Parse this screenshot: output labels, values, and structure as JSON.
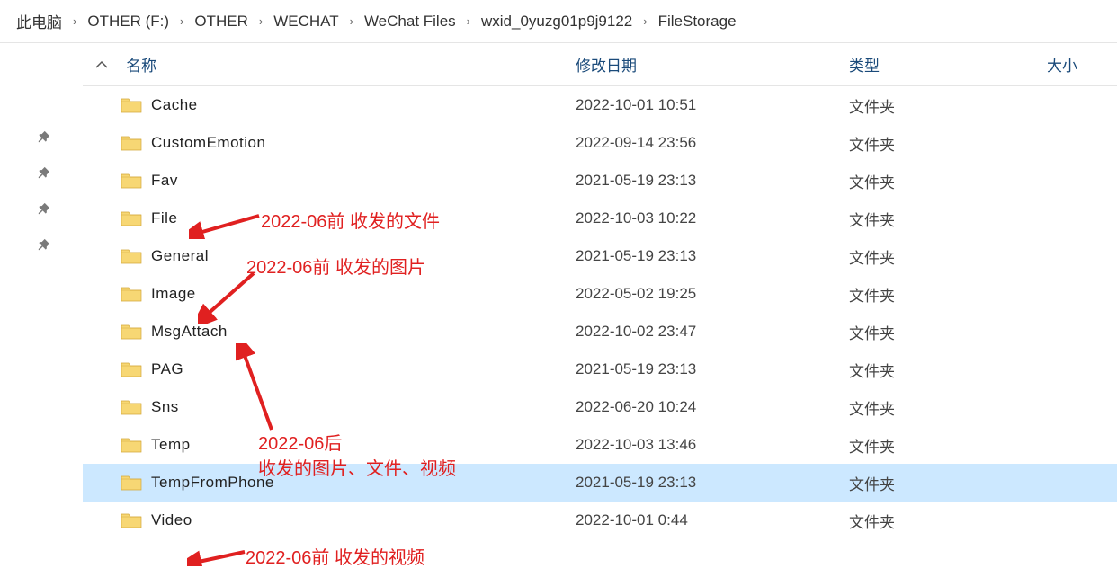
{
  "breadcrumb": [
    {
      "label": "此电脑"
    },
    {
      "label": "OTHER (F:)"
    },
    {
      "label": "OTHER"
    },
    {
      "label": "WECHAT"
    },
    {
      "label": "WeChat Files"
    },
    {
      "label": "wxid_0yuzg01p9j9122"
    },
    {
      "label": "FileStorage"
    }
  ],
  "headers": {
    "name": "名称",
    "date": "修改日期",
    "type": "类型",
    "size": "大小"
  },
  "rows": [
    {
      "name": "Cache",
      "date": "2022-10-01 10:51",
      "type": "文件夹"
    },
    {
      "name": "CustomEmotion",
      "date": "2022-09-14 23:56",
      "type": "文件夹"
    },
    {
      "name": "Fav",
      "date": "2021-05-19 23:13",
      "type": "文件夹"
    },
    {
      "name": "File",
      "date": "2022-10-03 10:22",
      "type": "文件夹"
    },
    {
      "name": "General",
      "date": "2021-05-19 23:13",
      "type": "文件夹"
    },
    {
      "name": "Image",
      "date": "2022-05-02 19:25",
      "type": "文件夹"
    },
    {
      "name": "MsgAttach",
      "date": "2022-10-02 23:47",
      "type": "文件夹"
    },
    {
      "name": "PAG",
      "date": "2021-05-19 23:13",
      "type": "文件夹"
    },
    {
      "name": "Sns",
      "date": "2022-06-20 10:24",
      "type": "文件夹"
    },
    {
      "name": "Temp",
      "date": "2022-10-03 13:46",
      "type": "文件夹"
    },
    {
      "name": "TempFromPhone",
      "date": "2021-05-19 23:13",
      "type": "文件夹"
    },
    {
      "name": "Video",
      "date": "2022-10-01 0:44",
      "type": "文件夹"
    }
  ],
  "annotations": {
    "a1": "2022-06前 收发的文件",
    "a2": "2022-06前 收发的图片",
    "a3_line1": "2022-06后",
    "a3_line2": "收发的图片、文件、视频",
    "a4": "2022-06前 收发的视频"
  }
}
